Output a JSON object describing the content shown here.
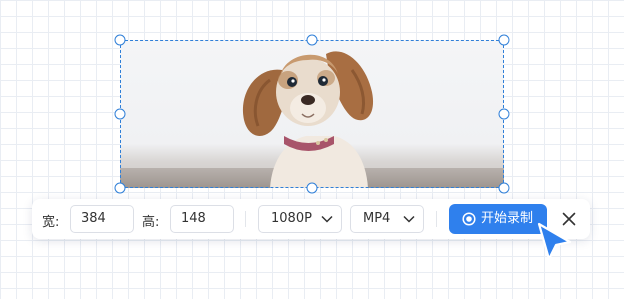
{
  "region": {
    "image_subject": "puppy photo",
    "selection_color": "#2f7fd8"
  },
  "toolbar": {
    "width_label": "宽:",
    "width_value": "384",
    "height_label": "高:",
    "height_value": "148",
    "resolution": "1080P",
    "format": "MP4",
    "record_label": "开始录制",
    "accent_color": "#2f80ed",
    "icons": {
      "record": "record-icon",
      "close": "close-icon",
      "dropdown": "chevron-down-icon",
      "cursor": "cursor-icon"
    }
  }
}
